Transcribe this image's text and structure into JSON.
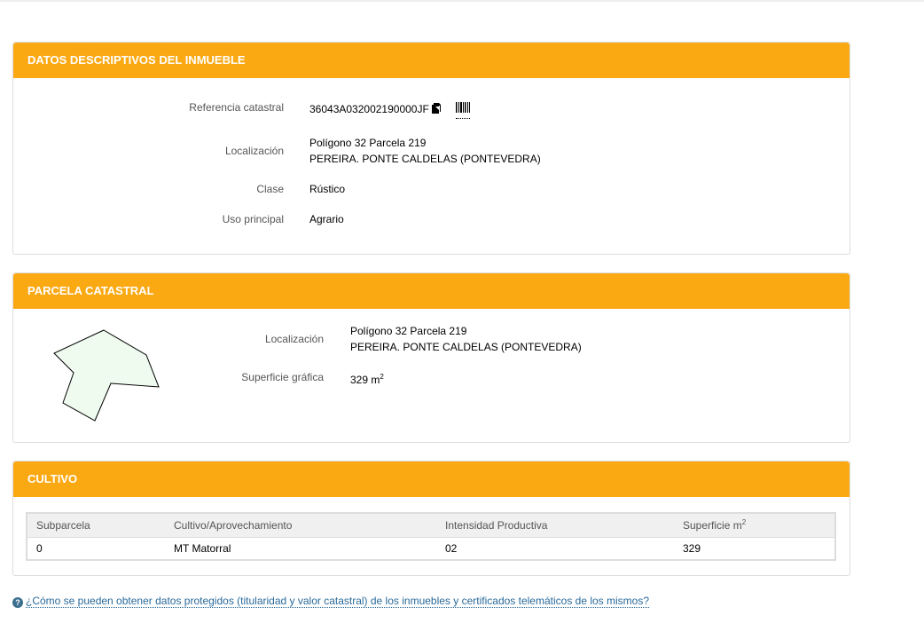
{
  "colors": {
    "header_bg": "#fba913",
    "parcel_fill": "#eefbee"
  },
  "datos": {
    "title": "DATOS DESCRIPTIVOS DEL INMUEBLE",
    "ref_label": "Referencia catastral",
    "ref_value": "36043A032002190000JF",
    "loc_label": "Localización",
    "loc_line1": "Polígono 32 Parcela 219",
    "loc_line2": "PEREIRA. PONTE CALDELAS (PONTEVEDRA)",
    "clase_label": "Clase",
    "clase_value": "Rústico",
    "uso_label": "Uso principal",
    "uso_value": "Agrario",
    "icons": [
      "copy-icon",
      "barcode-icon"
    ]
  },
  "parcela": {
    "title": "PARCELA CATASTRAL",
    "loc_label": "Localización",
    "loc_line1": "Polígono 32 Parcela 219",
    "loc_line2": "PEREIRA. PONTE CALDELAS (PONTEVEDRA)",
    "sup_label": "Superficie gráfica",
    "sup_value": "329 m",
    "sup_unit_sup": "2"
  },
  "cultivo": {
    "title": "CULTIVO",
    "headers": [
      "Subparcela",
      "Cultivo/Aprovechamiento",
      "Intensidad Productiva",
      "Superficie m"
    ],
    "header_sup": "2",
    "rows": [
      [
        "0",
        "MT Matorral",
        "02",
        "329"
      ]
    ]
  },
  "help": {
    "icon": "question-circle-icon",
    "text": "¿Cómo se pueden obtener datos protegidos (titularidad y valor catastral) de los inmuebles y certificados telemáticos de los mismos?"
  }
}
